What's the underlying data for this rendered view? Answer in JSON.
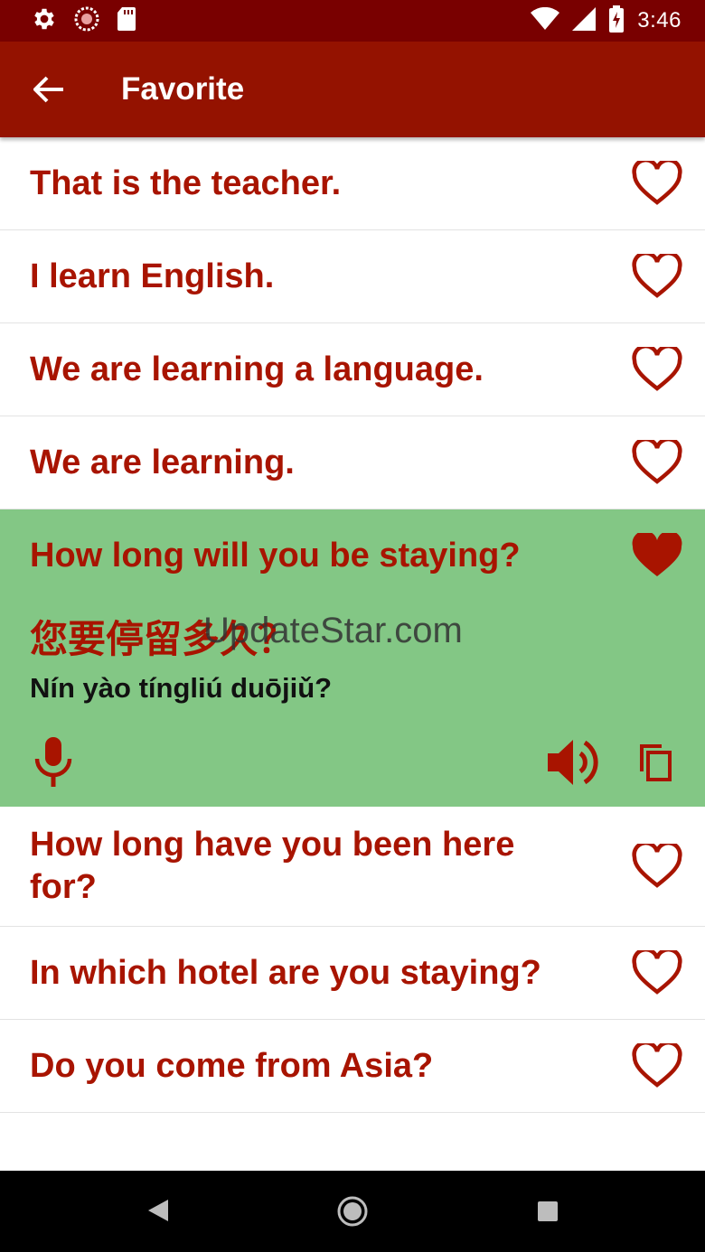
{
  "status_bar": {
    "time": "3:46",
    "icons": [
      "gear-icon",
      "sync-icon",
      "sd-card-icon",
      "wifi-icon",
      "signal-icon",
      "battery-charging-icon"
    ]
  },
  "app_bar": {
    "title": "Favorite",
    "back_icon": "arrow-left-icon"
  },
  "phrases": [
    {
      "text": "That is the teacher.",
      "favorite": false
    },
    {
      "text": "I learn English.",
      "favorite": false
    },
    {
      "text": "We are learning a language.",
      "favorite": false
    },
    {
      "text": "We are learning.",
      "favorite": false
    },
    {
      "text": "How long will you be staying?",
      "favorite": true,
      "chinese": "您要停留多久？",
      "pinyin": "Nín yào tíngliú duōjiǔ?"
    },
    {
      "text": "How long have you been here for?",
      "favorite": false
    },
    {
      "text": "In which hotel are you staying?",
      "favorite": false
    },
    {
      "text": "Do you come from Asia?",
      "favorite": false
    }
  ],
  "watermark": "UpdateStar.com",
  "colors": {
    "status_bar": "#790000",
    "app_bar": "#941200",
    "phrase_text": "#a81400",
    "expanded_bg": "#83c785",
    "heart": "#a81400"
  },
  "nav_bar": {
    "icons": [
      "back-triangle-icon",
      "home-circle-icon",
      "recents-square-icon"
    ]
  }
}
